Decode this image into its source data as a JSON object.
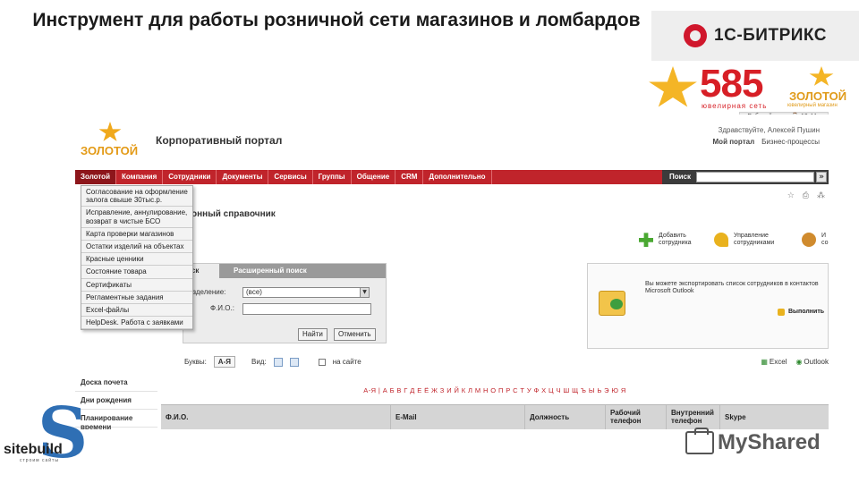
{
  "slide": {
    "title": "Инструмент для работы розничной сети магазинов и ломбардов"
  },
  "logos": {
    "bitrix": "1С-БИТРИКС",
    "brand_number": "585",
    "brand_sub": "ювелирная сеть",
    "zolotoy": "ЗОЛОТОЙ",
    "zolotoy_sub": "ювелирный магазин",
    "portal_logo": "ЗОЛОТОЙ",
    "sitebuild": "sitebuild",
    "sitebuild_tagline": "строим сайты",
    "myshared": "MyShared"
  },
  "portal": {
    "workday": "▪ Рабочий день: ⌚ 10:44",
    "title": "Корпоративный портал",
    "greeting": "Здравствуйте, Алексей Пушин",
    "my_portal": "Мой портал",
    "business_processes": "Бизнес-процессы",
    "menu": [
      "Золотой",
      "Компания",
      "Сотрудники",
      "Документы",
      "Сервисы",
      "Группы",
      "Общение",
      "CRM",
      "Дополнительно"
    ],
    "search_label": "Поиск",
    "search_go": "»",
    "tool_icons": [
      "☆",
      "⎙",
      "⁂"
    ],
    "page_heading": "онный справочник",
    "actions": {
      "add": "Добавить сотрудника",
      "manage": "Управление сотрудниками",
      "third": "И со"
    },
    "filter": {
      "tab_basic": "иск",
      "tab_advanced": "Расширенный поиск",
      "dept_label": "азделение:",
      "dept_value": "(все)",
      "fio_label": "Ф.И.О.:",
      "find_button": "Найти",
      "cancel_button": "Отменить"
    },
    "export": {
      "text": "Вы можете экспортировать список сотрудников в контактов Microsoft Outlook",
      "run": "Выполнить"
    },
    "dropdown": [
      "Согласование на оформление залога свыше 30тыс.р.",
      "Исправление, аннулирование, возврат в чистые БСО",
      "Карта проверки магазинов",
      "Остатки изделий на объектах",
      "Красные ценники",
      "Состояние товара",
      "Сертификаты",
      "Регламентные задания",
      "Excel-файлы",
      "HelpDesk. Работа с заявками"
    ],
    "leftnav": [
      "Доска почета",
      "Дни рождения",
      "Планирование времени"
    ],
    "view": {
      "letter_label": "Буквы:",
      "az": "А-Я",
      "view_label": "Вид:",
      "online": "на сайте",
      "excel": "Excel",
      "outlook": "Outlook"
    },
    "alphabet": "А-Я | А Б В Г Д Е Ё Ж З И Й К Л М Н О П Р С Т У Ф Х Ц Ч Ш Щ Ъ Ы Ь Э Ю Я",
    "table_headers": [
      "Ф.И.О.",
      "E-Mail",
      "Должность",
      "Рабочий телефон",
      "Внутренний телефон",
      "Skype"
    ]
  }
}
